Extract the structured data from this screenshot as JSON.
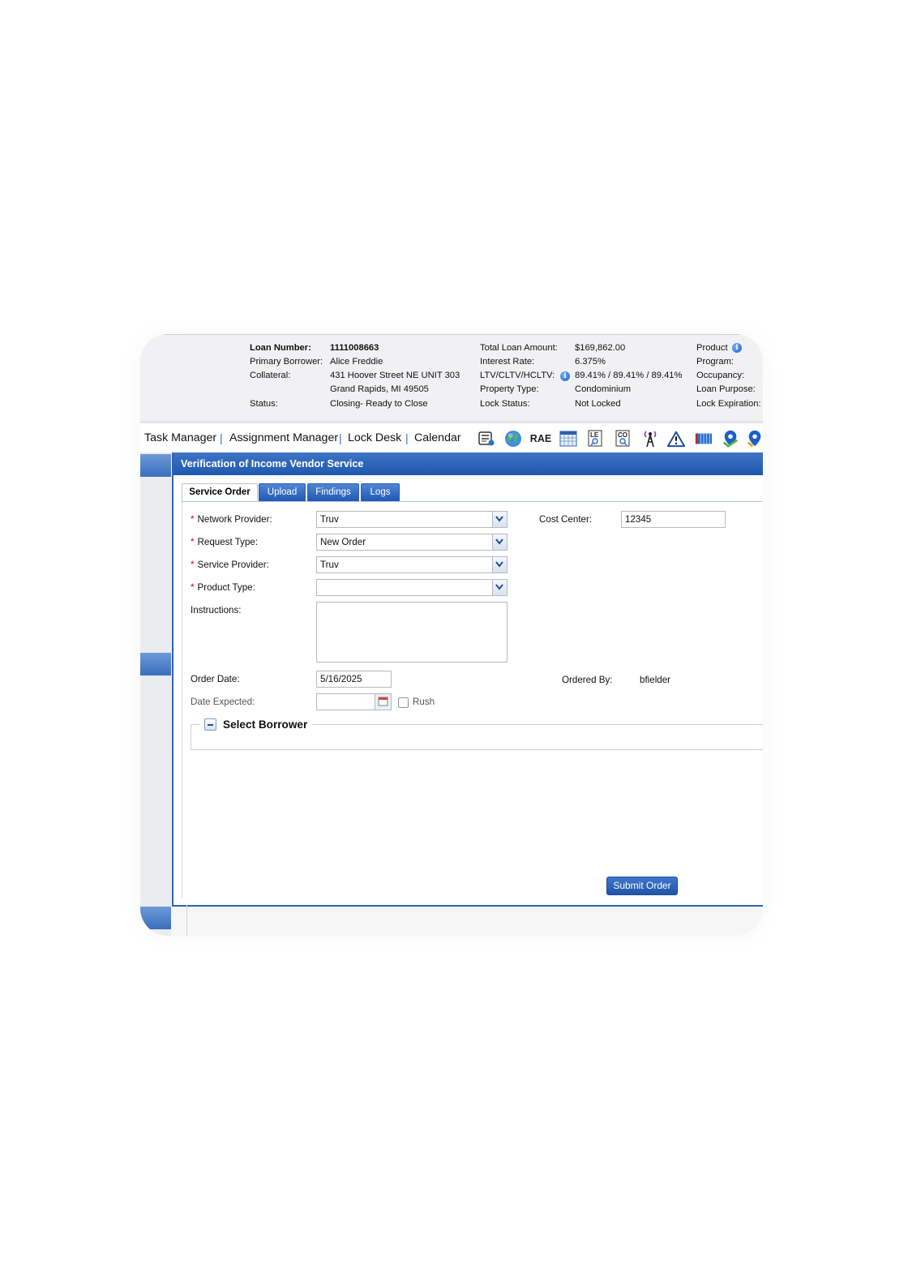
{
  "loan_header": {
    "col1": {
      "loan_number_label": "Loan Number:",
      "loan_number": "1111008663",
      "primary_borrower_label": "Primary Borrower:",
      "primary_borrower": "Alice Freddie",
      "collateral_label": "Collateral:",
      "collateral_line1": "431 Hoover Street NE UNIT 303",
      "collateral_line2": "Grand Rapids, MI 49505",
      "status_label": "Status:",
      "status": "Closing- Ready to Close"
    },
    "col2": {
      "total_loan_amount_label": "Total Loan Amount:",
      "total_loan_amount": "$169,862.00",
      "interest_rate_label": "Interest Rate:",
      "interest_rate": "6.375%",
      "ltv_label": "LTV/CLTV/HCLTV:",
      "ltv": "89.41% / 89.41% / 89.41%",
      "property_type_label": "Property Type:",
      "property_type": "Condominium",
      "lock_status_label": "Lock Status:",
      "lock_status": "Not Locked"
    },
    "col3": {
      "product_label": "Product",
      "program_label": "Program:",
      "occupancy_label": "Occupancy:",
      "loan_purpose_label": "Loan Purpose:",
      "lock_expiration_label": "Lock Expiration:"
    }
  },
  "nav": {
    "task_manager": "Task Manager",
    "assignment_manager": "Assignment Manager",
    "lock_desk": "Lock Desk",
    "calendar": "Calendar",
    "separator": "|",
    "rae": "RAE",
    "le_icon_text": "LE",
    "co_icon_text": "CO",
    "icons": [
      "document-card-icon",
      "globe-icon",
      "rae-button",
      "calendar-grid-icon",
      "le-search-icon",
      "co-search-icon",
      "antenna-icon",
      "warning-icon",
      "grid-table-icon",
      "map-pin-icon",
      "map-pin-icon-2"
    ]
  },
  "panel": {
    "title": "Verification of Income Vendor Service",
    "tabs": [
      "Service Order",
      "Upload",
      "Findings",
      "Logs"
    ],
    "active_tab": "Service Order"
  },
  "form": {
    "required_marker": "*",
    "network_provider_label": "Network Provider:",
    "network_provider": "Truv",
    "request_type_label": "Request Type:",
    "request_type": "New Order",
    "service_provider_label": "Service Provider:",
    "service_provider": "Truv",
    "product_type_label": "Product Type:",
    "product_type": "",
    "instructions_label": "Instructions:",
    "instructions": "",
    "cost_center_label": "Cost Center:",
    "cost_center": "12345",
    "order_date_label": "Order Date:",
    "order_date": "5/16/2025",
    "ordered_by_label": "Ordered By:",
    "ordered_by": "bfielder",
    "date_expected_label": "Date Expected:",
    "date_expected": "",
    "rush_label": "Rush",
    "rush_checked": false,
    "select_borrower_label": "Select Borrower",
    "submit_label": "Submit Order"
  },
  "colors": {
    "accent": "#2058b2",
    "required": "#cc0000",
    "header_bg": "#f1f1f3"
  }
}
